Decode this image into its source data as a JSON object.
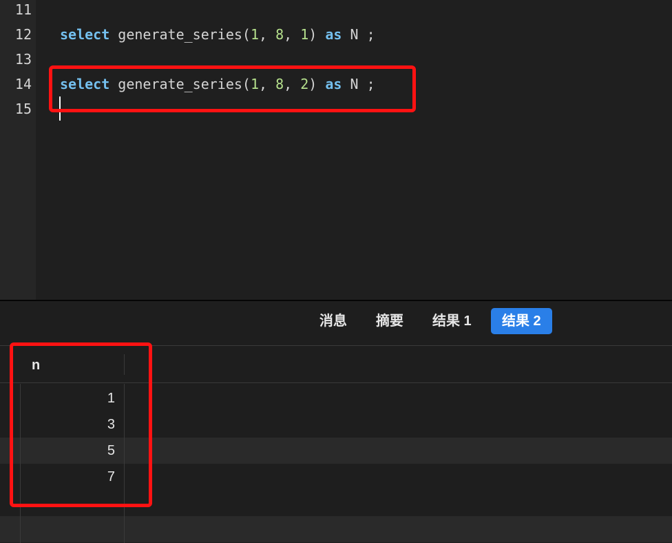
{
  "editor": {
    "lines": [
      {
        "number": "11",
        "code": []
      },
      {
        "number": "12",
        "code": [
          {
            "t": "select",
            "c": "kw"
          },
          {
            "t": " generate_series(",
            "c": "plain"
          },
          {
            "t": "1",
            "c": "num"
          },
          {
            "t": ", ",
            "c": "plain"
          },
          {
            "t": "8",
            "c": "num"
          },
          {
            "t": ", ",
            "c": "plain"
          },
          {
            "t": "1",
            "c": "num"
          },
          {
            "t": ") ",
            "c": "plain"
          },
          {
            "t": "as",
            "c": "kw"
          },
          {
            "t": " N ;",
            "c": "plain"
          }
        ]
      },
      {
        "number": "13",
        "code": []
      },
      {
        "number": "14",
        "code": [
          {
            "t": "select",
            "c": "kw"
          },
          {
            "t": " generate_series(",
            "c": "plain"
          },
          {
            "t": "1",
            "c": "num"
          },
          {
            "t": ", ",
            "c": "plain"
          },
          {
            "t": "8",
            "c": "num"
          },
          {
            "t": ", ",
            "c": "plain"
          },
          {
            "t": "2",
            "c": "num"
          },
          {
            "t": ") ",
            "c": "plain"
          },
          {
            "t": "as",
            "c": "kw"
          },
          {
            "t": " N ;",
            "c": "plain"
          }
        ]
      },
      {
        "number": "15",
        "code": []
      }
    ]
  },
  "tabs": [
    {
      "label": "消息",
      "active": false
    },
    {
      "label": "摘要",
      "active": false
    },
    {
      "label": "结果 1",
      "active": false
    },
    {
      "label": "结果 2",
      "active": true
    }
  ],
  "results": {
    "column": "n",
    "rows": [
      "1",
      "3",
      "5",
      "7"
    ]
  },
  "colors": {
    "keyword": "#74c0ef",
    "number": "#b5e08c",
    "annotation": "#ff1212",
    "active_tab": "#2a7fe8"
  }
}
